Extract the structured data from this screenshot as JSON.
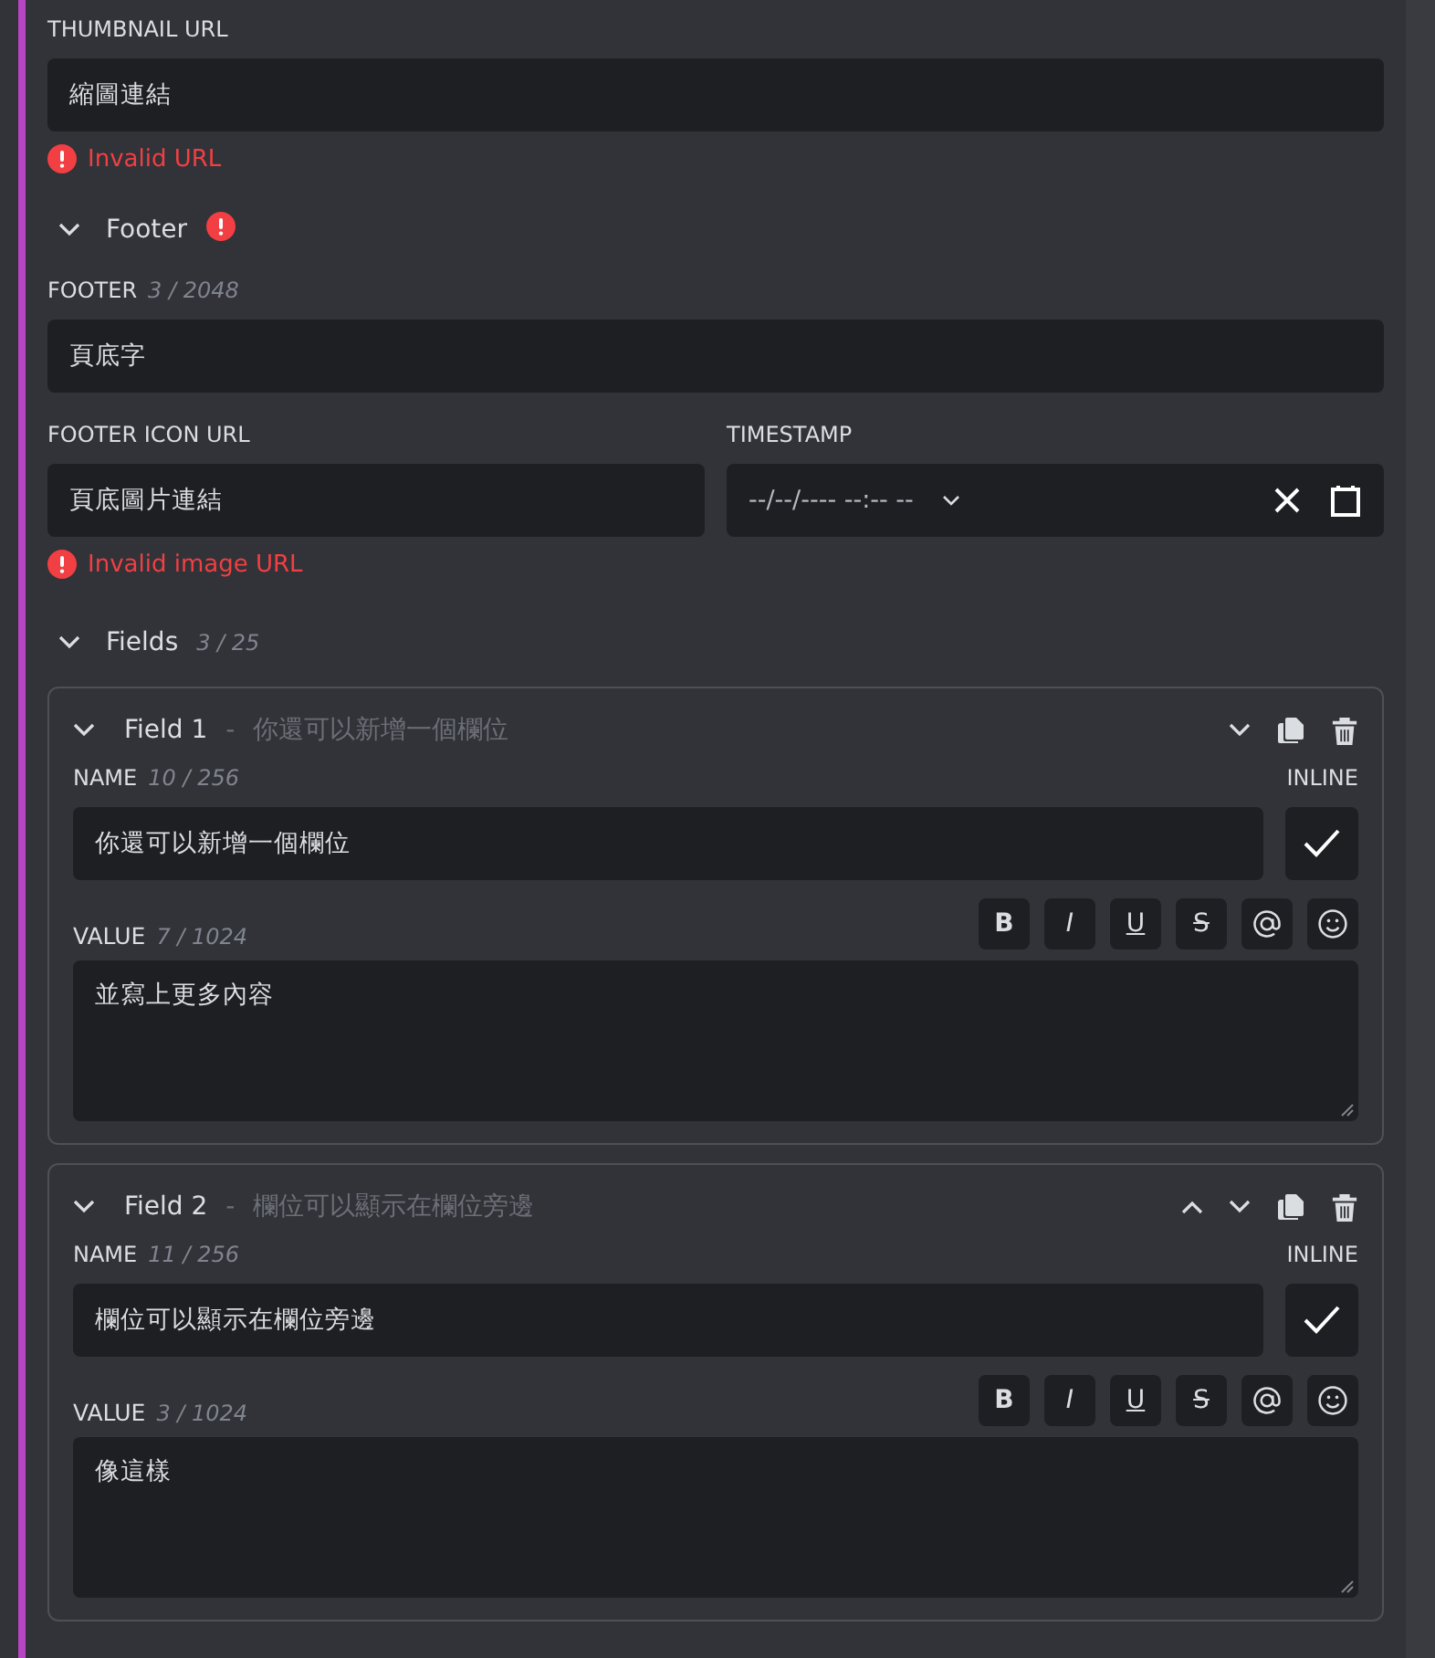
{
  "thumbnail": {
    "label": "THUMBNAIL URL",
    "value": "縮圖連結",
    "error": "Invalid URL"
  },
  "footer_section": {
    "title": "Footer",
    "expanded": true,
    "has_error": true
  },
  "footer": {
    "label": "FOOTER",
    "counter": "3 / 2048",
    "value": "頁底字"
  },
  "footer_icon": {
    "label": "FOOTER ICON URL",
    "value": "頁底圖片連結",
    "error": "Invalid image URL"
  },
  "timestamp": {
    "label": "TIMESTAMP",
    "value": "--/--/---- --:-- --"
  },
  "fields_section": {
    "title": "Fields",
    "counter": "3 / 25",
    "expanded": true
  },
  "fields": [
    {
      "title": "Field 1",
      "separator": "-",
      "preview": "你還可以新增一個欄位",
      "expanded": true,
      "move_up": false,
      "move_down": true,
      "name_label": "NAME",
      "name_counter": "10 / 256",
      "name": "你還可以新增一個欄位",
      "inline_label": "INLINE",
      "inline": true,
      "value_label": "VALUE",
      "value_counter": "7 / 1024",
      "value": "並寫上更多內容",
      "format_buttons": [
        "B",
        "I",
        "U",
        "S"
      ]
    },
    {
      "title": "Field 2",
      "separator": "-",
      "preview": "欄位可以顯示在欄位旁邊",
      "expanded": true,
      "move_up": true,
      "move_down": true,
      "name_label": "NAME",
      "name_counter": "11 / 256",
      "name": "欄位可以顯示在欄位旁邊",
      "inline_label": "INLINE",
      "inline": true,
      "value_label": "VALUE",
      "value_counter": "3 / 1024",
      "value": "像這樣",
      "format_buttons": [
        "B",
        "I",
        "U",
        "S"
      ]
    }
  ]
}
